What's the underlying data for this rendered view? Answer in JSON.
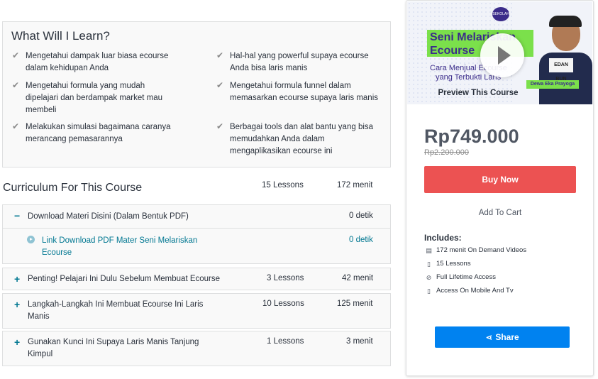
{
  "learn": {
    "title": "What Will I Learn?",
    "items": [
      "Mengetahui dampak luar biasa ecourse dalam kehidupan Anda",
      "Hal-hal yang powerful supaya ecourse Anda bisa laris manis",
      "Mengetahui formula yang mudah dipelajari dan berdampak market mau membeli",
      "Mengetahui formula funnel dalam memasarkan ecourse supaya laris manis",
      "Melakukan simulasi bagaimana caranya merancang pemasarannya",
      "Berbagai tools dan alat bantu yang bisa memudahkan Anda dalam mengaplikasikan ecourse ini"
    ]
  },
  "curriculum": {
    "title": "Curriculum For This Course",
    "lessons": "15 Lessons",
    "time": "172 menit",
    "sections": [
      {
        "sign": "−",
        "name": "Download Materi Disini (Dalam Bentuk PDF)",
        "count": "",
        "duration": "0 detik"
      },
      {
        "sign": "+",
        "name": "Penting! Pelajari Ini Dulu Sebelum Membuat Ecourse",
        "count": "3 Lessons",
        "duration": "42 menit"
      },
      {
        "sign": "+",
        "name": "Langkah-Langkah Ini Membuat Ecourse Ini Laris Manis",
        "count": "10 Lessons",
        "duration": "125 menit"
      },
      {
        "sign": "+",
        "name": "Gunakan Kunci Ini Supaya Laris Manis Tanjung Kimpul",
        "count": "1 Lessons",
        "duration": "3 menit"
      }
    ],
    "lecture": {
      "name": "Link Download PDF Mater Seni Melariskan Ecourse",
      "duration": "0 detik"
    }
  },
  "sidebar": {
    "preview": {
      "badge": "SEKOLAH",
      "title_line1": "Seni Melariskan",
      "title_line2": "Ecourse",
      "sub_line1": "Cara Menjual Ecourse",
      "sub_line2": "yang Terbukti Laris",
      "shirt_text": "EDAN BUN",
      "presenter": "Dewa Eka Prayoga",
      "label": "Preview This Course"
    },
    "price": "Rp749.000",
    "old_price": "Rp2.200.000",
    "buy_label": "Buy Now",
    "cart_label": "Add To Cart",
    "includes_title": "Includes:",
    "includes": [
      {
        "icon": "video-file-icon",
        "text": "172 menit On Demand Videos"
      },
      {
        "icon": "file-icon",
        "text": "15 Lessons"
      },
      {
        "icon": "lifetime-icon",
        "text": "Full Lifetime Access"
      },
      {
        "icon": "mobile-icon",
        "text": "Access On Mobile And Tv"
      }
    ],
    "share_label": "Share"
  },
  "colors": {
    "accent_teal": "#007791",
    "buy_red": "#ec5252",
    "share_blue": "#0082f0",
    "text": "#29303b"
  }
}
